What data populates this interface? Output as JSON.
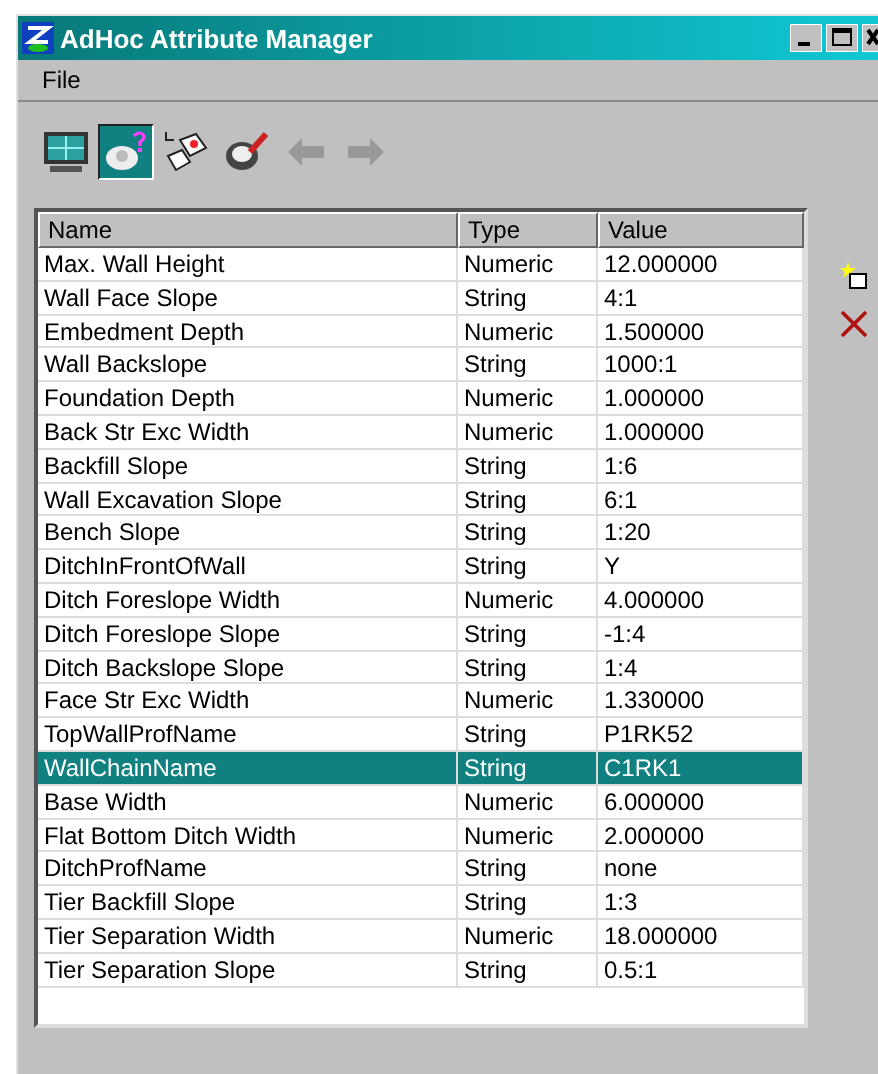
{
  "window": {
    "title": "AdHoc Attribute Manager"
  },
  "menu": [
    "File"
  ],
  "toolbar": [
    {
      "selected": false,
      "disabled": false
    },
    {
      "selected": true,
      "disabled": false
    },
    {
      "selected": false,
      "disabled": false
    },
    {
      "selected": false,
      "disabled": false
    },
    {
      "selected": false,
      "disabled": true
    },
    {
      "selected": false,
      "disabled": true
    }
  ],
  "table": {
    "columns": [
      "Name",
      "Type",
      "Value"
    ],
    "rows": [
      {
        "name": "Max. Wall Height",
        "type": "Numeric",
        "value": "12.000000",
        "selected": false
      },
      {
        "name": "Wall Face Slope",
        "type": "String",
        "value": "4:1",
        "selected": false
      },
      {
        "name": "Embedment Depth",
        "type": "Numeric",
        "value": "1.500000",
        "selected": false
      },
      {
        "name": "Wall Backslope",
        "type": "String",
        "value": "1000:1",
        "selected": false
      },
      {
        "name": "Foundation Depth",
        "type": "Numeric",
        "value": "1.000000",
        "selected": false
      },
      {
        "name": "Back Str Exc Width",
        "type": "Numeric",
        "value": "1.000000",
        "selected": false
      },
      {
        "name": "Backfill Slope",
        "type": "String",
        "value": "1:6",
        "selected": false
      },
      {
        "name": "Wall Excavation Slope",
        "type": "String",
        "value": "6:1",
        "selected": false
      },
      {
        "name": "Bench Slope",
        "type": "String",
        "value": "1:20",
        "selected": false
      },
      {
        "name": "DitchInFrontOfWall",
        "type": "String",
        "value": "Y",
        "selected": false
      },
      {
        "name": "Ditch Foreslope Width",
        "type": "Numeric",
        "value": "4.000000",
        "selected": false
      },
      {
        "name": "Ditch Foreslope Slope",
        "type": "String",
        "value": "-1:4",
        "selected": false
      },
      {
        "name": "Ditch Backslope Slope",
        "type": "String",
        "value": "1:4",
        "selected": false
      },
      {
        "name": "Face Str Exc Width",
        "type": "Numeric",
        "value": "1.330000",
        "selected": false
      },
      {
        "name": "TopWallProfName",
        "type": "String",
        "value": "P1RK52",
        "selected": false
      },
      {
        "name": "WallChainName",
        "type": "String",
        "value": "C1RK1",
        "selected": true
      },
      {
        "name": "Base Width",
        "type": "Numeric",
        "value": "6.000000",
        "selected": false
      },
      {
        "name": "Flat Bottom Ditch Width",
        "type": "Numeric",
        "value": "2.000000",
        "selected": false
      },
      {
        "name": "DitchProfName",
        "type": "String",
        "value": "none",
        "selected": false
      },
      {
        "name": "Tier Backfill Slope",
        "type": "String",
        "value": "1:3",
        "selected": false
      },
      {
        "name": "Tier Separation Width",
        "type": "Numeric",
        "value": "18.000000",
        "selected": false
      },
      {
        "name": "Tier Separation Slope",
        "type": "String",
        "value": "0.5:1",
        "selected": false
      }
    ]
  }
}
